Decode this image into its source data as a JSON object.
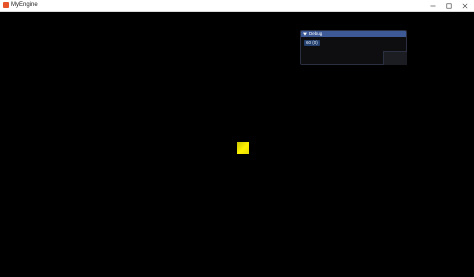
{
  "window": {
    "title": "MyEngine",
    "icon": "app-logo-icon",
    "controls": [
      "minimize-icon",
      "maximize-icon",
      "close-icon"
    ]
  },
  "scene": {
    "background": "#000000",
    "object": {
      "shape": "cube",
      "color": "#fff200"
    }
  },
  "debug": {
    "title": "Debug",
    "header_color": "#3d5a96",
    "fps": "60 (0)"
  }
}
